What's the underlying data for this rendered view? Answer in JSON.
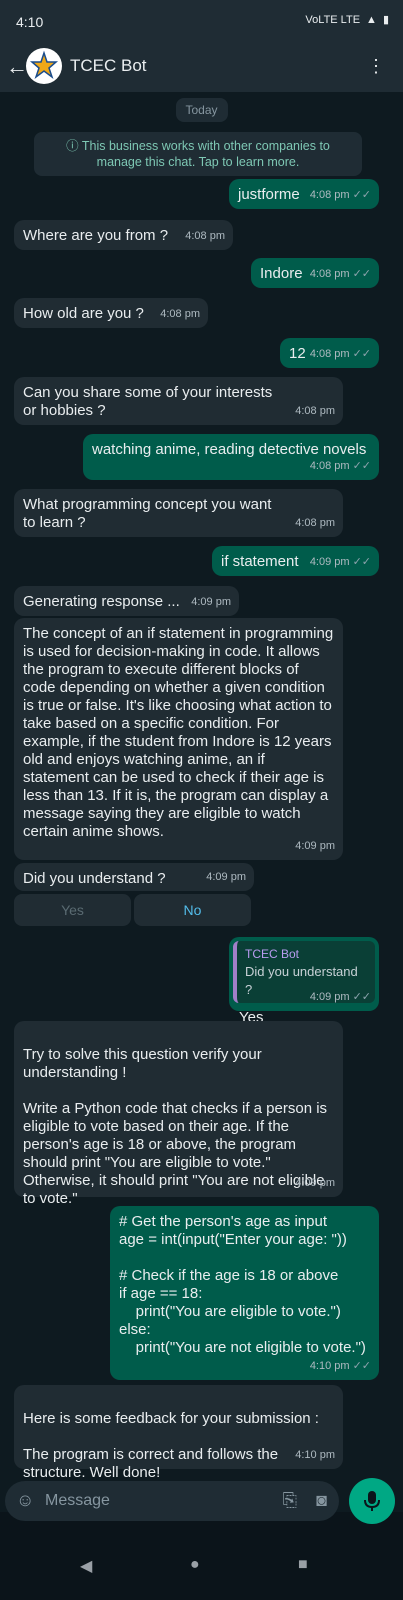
{
  "status_bar": {
    "time": "4:10",
    "network": "VoLTE LTE"
  },
  "header": {
    "title": "TCEC Bot"
  },
  "chat": {
    "date_chip": "Today",
    "notice": "This business works with other companies to manage this chat. Tap to learn more.",
    "messages": [
      {
        "text": "justforme",
        "time": "4:08 pm"
      },
      {
        "text": "Where are you from ?",
        "time": "4:08 pm"
      },
      {
        "text": "Indore",
        "time": "4:08 pm"
      },
      {
        "text": "How old are you ?",
        "time": "4:08 pm"
      },
      {
        "text": "12",
        "time": "4:08 pm"
      },
      {
        "text": "Can you share some of your interests or hobbies ?",
        "time": "4:08 pm"
      },
      {
        "text": "watching anime, reading detective novels",
        "time": "4:08 pm"
      },
      {
        "text": "What programming concept you want to learn ?",
        "time": "4:08 pm"
      },
      {
        "text": "if statement",
        "time": "4:09 pm"
      },
      {
        "text": "Generating response ...",
        "time": "4:09 pm"
      },
      {
        "text": "The concept of an if statement in programming is used for decision-making in code. It allows the program to execute different blocks of code depending on whether a given condition is true or false. It's like choosing what action to take based on a specific condition. For example, if the student from Indore is 12 years old and enjoys watching anime, an if statement can be used to check if their age is less than 13. If it is, the program can display a message saying they are eligible to watch certain anime shows.",
        "time": "4:09 pm"
      },
      {
        "text": "Did you understand ?",
        "time": "4:09 pm",
        "buttons": [
          "Yes",
          "No"
        ]
      },
      {
        "reply_name": "TCEC Bot",
        "reply_text": "Did you understand ?",
        "text": "Yes",
        "time": "4:09 pm"
      },
      {
        "text": "Try to solve this question verify your understanding !\n\nWrite a Python code that checks if a person is eligible to vote based on their age. If the person's age is 18 or above, the program should print \"You are eligible to vote.\" Otherwise, it should print \"You are not eligible to vote.\"",
        "time": "4:09 pm"
      },
      {
        "text": "# Get the person's age as input\nage = int(input(\"Enter your age: \"))\n\n# Check if the age is 18 or above\nif age == 18:\n    print(\"You are eligible to vote.\")\nelse:\n    print(\"You are not eligible to vote.\")",
        "time": "4:10 pm"
      },
      {
        "text": "Here is some feedback for your submission :\n\nThe program is correct and follows the structure. Well done!",
        "time": "4:10 pm"
      }
    ]
  },
  "composer": {
    "placeholder": "Message"
  },
  "colors": {
    "incoming": "#202c33",
    "outgoing": "#005c4b",
    "accent": "#00a884"
  }
}
